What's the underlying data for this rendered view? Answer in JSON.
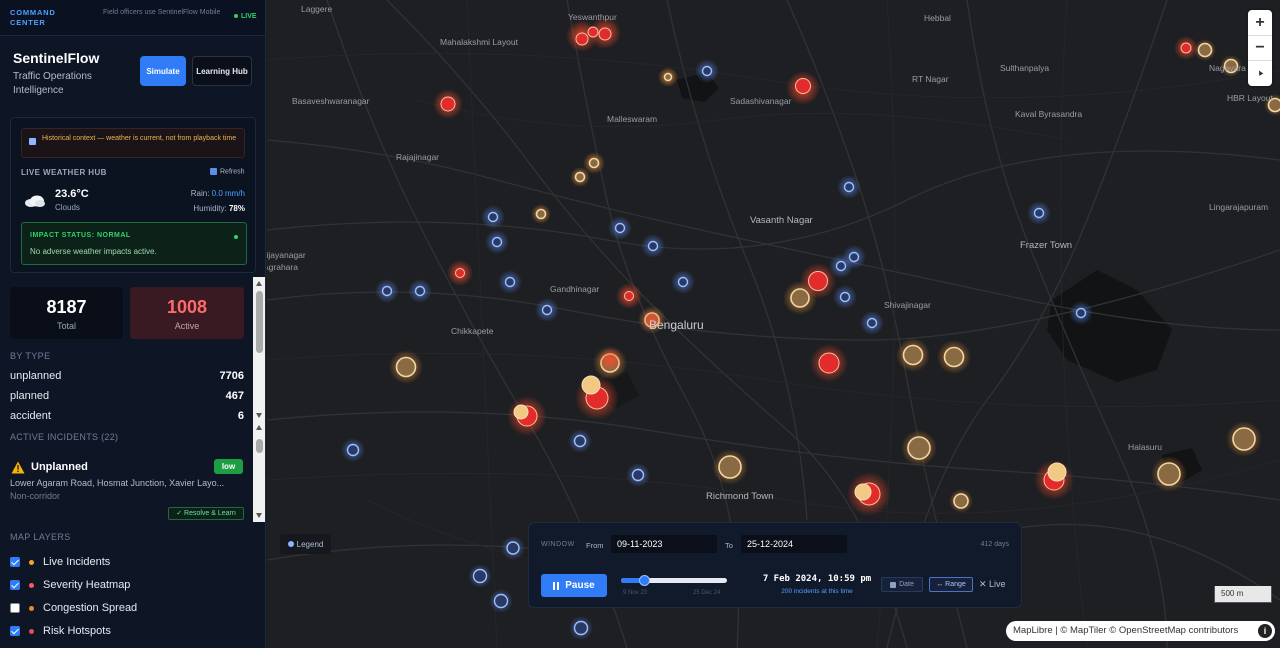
{
  "header": {
    "command_center": "COMMAND CENTER",
    "field_note": "Field officers use SentinelFlow Mobile",
    "live": "LIVE"
  },
  "brand": {
    "name": "SentinelFlow",
    "subtitle": "Traffic Operations Intelligence",
    "simulate": "Simulate",
    "learning_hub": "Learning Hub"
  },
  "weather": {
    "historical_notice": "Historical context — weather is current, not from playback time",
    "title": "LIVE WEATHER HUB",
    "refresh": "Refresh",
    "temp": "23.6°C",
    "condition": "Clouds",
    "rain_label": "Rain:",
    "rain_value": "0.0 mm/h",
    "humidity_label": "Humidity:",
    "humidity_value": "78%",
    "impact_title": "IMPACT STATUS: NORMAL",
    "impact_text": "No adverse weather impacts active."
  },
  "stats": {
    "total": "8187",
    "total_label": "Total",
    "active": "1008",
    "active_label": "Active"
  },
  "by_type": {
    "title": "BY TYPE",
    "rows": [
      {
        "label": "unplanned",
        "value": "7706"
      },
      {
        "label": "planned",
        "value": "467"
      },
      {
        "label": "accident",
        "value": "6"
      }
    ]
  },
  "incidents": {
    "title": "ACTIVE INCIDENTS (22)",
    "first": {
      "type": "Unplanned",
      "severity": "low",
      "address": "Lower Agaram Road, Hosmat Junction, Xavier Layo...",
      "corridor": "Non-corridor",
      "action": "✓ Resolve & Learn"
    }
  },
  "layers": {
    "title": "MAP LAYERS",
    "items": [
      {
        "label": "Live Incidents",
        "checked": true,
        "color": "#f5a623"
      },
      {
        "label": "Severity Heatmap",
        "checked": true,
        "color": "#ff5a5a"
      },
      {
        "label": "Congestion Spread",
        "checked": false,
        "color": "#f08a24"
      },
      {
        "label": "Risk Hotspots",
        "checked": true,
        "color": "#e64b5a"
      }
    ]
  },
  "map": {
    "places": [
      "Laggere",
      "Yeswanthpur",
      "Hebbal",
      "Mahalakshmi Layout",
      "RT Nagar",
      "Sulthanpalya",
      "Nagavara",
      "Basaveshwaranagar",
      "Sadashivanagar",
      "HBR Layout",
      "Malleswaram",
      "Kaval Byrasandra",
      "Rajajinagar",
      "Lingarajapuram",
      "Vasanth Nagar",
      "Frazer Town",
      "Vijayanagar",
      "Agrahara",
      "Gandhinagar",
      "Shivajinagar",
      "Chikkapete",
      "Bengaluru",
      "Richmond Town",
      "Halasuru"
    ],
    "legend": "Legend",
    "zoom_in": "+",
    "zoom_out": "−",
    "compass": "▲",
    "scale": "500 m",
    "attribution": "MapLibre | © MapTiler © OpenStreetMap contributors",
    "info": "i"
  },
  "timeline": {
    "window_label": "WINDOW",
    "from_label": "From",
    "from_value": "09-11-2023",
    "to_label": "To",
    "to_value": "25-12-2024",
    "days": "412 days",
    "pause": "Pause",
    "progress": 0.22,
    "range_start": "9 Nov 23",
    "range_end": "25 Dec 24",
    "current_time": "7 Feb 2024, 10:59 pm",
    "incident_count": "200 incidents at this time",
    "date_btn": "Date",
    "range_btn": "↔ Range",
    "live_btn": "✕ Live"
  },
  "colors": {
    "accent": "#2f7cf6",
    "live_green": "#2fd36b",
    "active_red": "#ff6b6b",
    "marker_blue": "#8fb6ff",
    "marker_amber": "#d9a55a",
    "marker_red": "#e53030"
  }
}
